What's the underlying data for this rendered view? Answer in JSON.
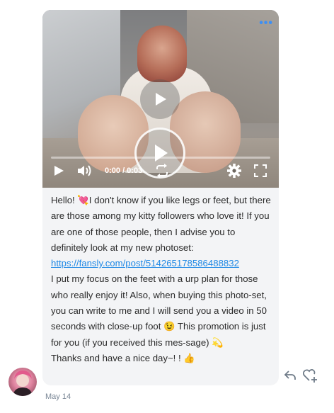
{
  "video": {
    "time": "0:00 / 0:03",
    "progress": 0,
    "icons": {
      "more": "more-dots-icon",
      "play": "play-icon",
      "volume": "volume-icon",
      "loop": "loop-icon",
      "settings": "gear-icon",
      "fullscreen": "fullscreen-icon"
    }
  },
  "message": {
    "segments": [
      {
        "type": "text",
        "value": "Hello! 💘I don't know if you like legs or feet, but there are those among my kitty followers who love it! If you are one of those people, then I advise you to definitely look at my new photoset: "
      },
      {
        "type": "link",
        "value": "https://fansly.com/post/514265178586488832"
      },
      {
        "type": "text",
        "value": "\nI put my focus on the feet with a urp plan for those who really enjoy it! Also, when buying this photo-set, you can write to me and I will send you a video in 50 seconds with close-up foot 😉 This promotion is just for you (if you received this mes-sage) 💫\nThanks and have a nice day~! ! 👍"
      }
    ]
  },
  "footer": {
    "date": "May 14",
    "icons": {
      "reply": "reply-icon",
      "like": "heart-plus-icon",
      "avatar": "avatar"
    }
  },
  "colors": {
    "link": "#1e88e5",
    "accent": "#3d8ff5",
    "bubble": "#f3f4f6"
  }
}
